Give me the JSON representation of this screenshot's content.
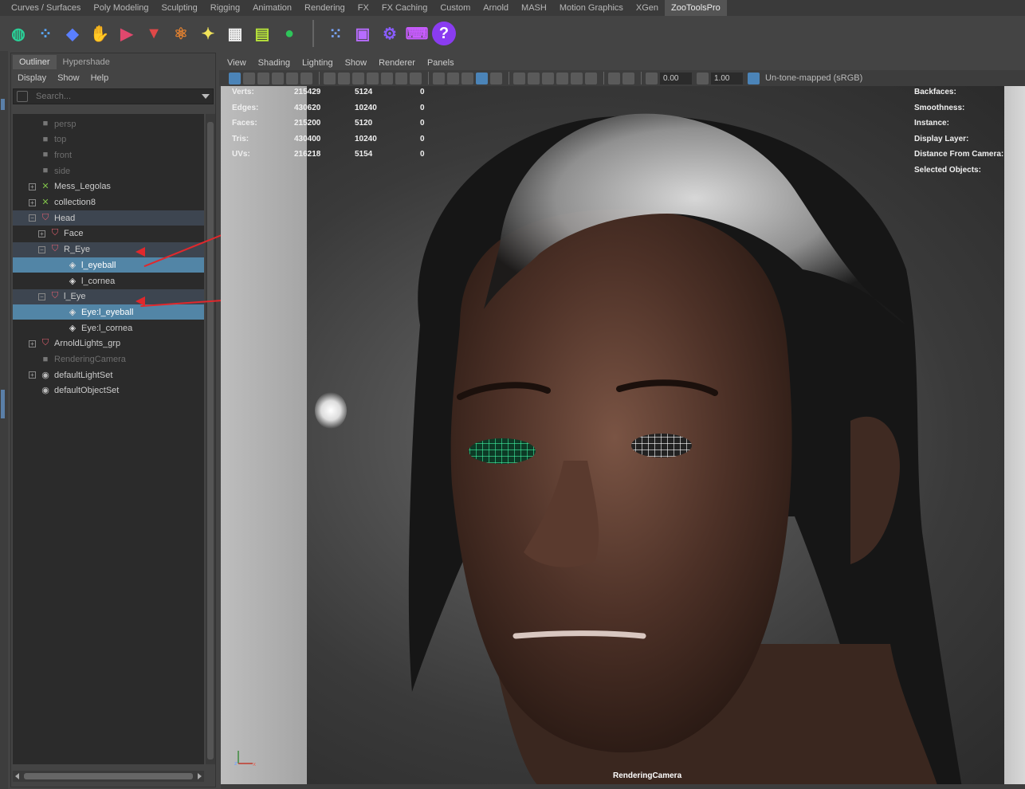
{
  "shelf_tabs": [
    "Curves / Surfaces",
    "Poly Modeling",
    "Sculpting",
    "Rigging",
    "Animation",
    "Rendering",
    "FX",
    "FX Caching",
    "Custom",
    "Arnold",
    "MASH",
    "Motion Graphics",
    "XGen",
    "ZooToolsPro"
  ],
  "active_shelf_tab": "ZooToolsPro",
  "shelf_icons": [
    "globe-icon",
    "dots-icon",
    "cube-icon",
    "rig-icon",
    "camera-icon",
    "paint-icon",
    "atom-icon",
    "bulb-icon",
    "checker-icon",
    "clapper-icon",
    "sphere-icon",
    "|",
    "zoo-dots-icon",
    "zoo-window-icon",
    "zoo-gear-icon",
    "zoo-keyboard-icon",
    "zoo-help-icon"
  ],
  "outliner": {
    "tabs": [
      "Outliner",
      "Hypershade"
    ],
    "menu": [
      "Display",
      "Show",
      "Help"
    ],
    "search_placeholder": "Search...",
    "rows": [
      {
        "label": "persp",
        "icon": "camera-icon",
        "level": 2,
        "dim": true
      },
      {
        "label": "top",
        "icon": "camera-icon",
        "level": 2,
        "dim": true
      },
      {
        "label": "front",
        "icon": "camera-icon",
        "level": 2,
        "dim": true
      },
      {
        "label": "side",
        "icon": "camera-icon",
        "level": 2,
        "dim": true
      },
      {
        "label": "Mess_Legolas",
        "icon": "set-icon",
        "level": 2,
        "expander": "+"
      },
      {
        "label": "collection8",
        "icon": "set-icon",
        "level": 2,
        "expander": "+"
      },
      {
        "label": "Head",
        "icon": "group-icon",
        "level": 2,
        "expander": "-",
        "parent": true
      },
      {
        "label": "Face",
        "icon": "group-icon",
        "level": 3,
        "expander": "+"
      },
      {
        "label": "R_Eye",
        "icon": "group-icon",
        "level": 3,
        "expander": "-",
        "parent": true
      },
      {
        "label": "l_eyeball",
        "icon": "mesh-icon",
        "level": 4,
        "selected": true
      },
      {
        "label": "l_cornea",
        "icon": "mesh-icon",
        "level": 4
      },
      {
        "label": "l_Eye",
        "icon": "group-icon",
        "level": 3,
        "expander": "-",
        "parent": true
      },
      {
        "label": "Eye:l_eyeball",
        "icon": "mesh-icon",
        "level": 4,
        "selected": true
      },
      {
        "label": "Eye:l_cornea",
        "icon": "mesh-icon",
        "level": 4
      },
      {
        "label": "ArnoldLights_grp",
        "icon": "group-icon",
        "level": 2,
        "expander": "+"
      },
      {
        "label": "RenderingCamera",
        "icon": "camera-icon",
        "level": 2,
        "dim": true
      },
      {
        "label": "defaultLightSet",
        "icon": "lightset-icon",
        "level": 2,
        "expander": "+"
      },
      {
        "label": "defaultObjectSet",
        "icon": "lightset-icon",
        "level": 2
      }
    ]
  },
  "viewport": {
    "menu": [
      "View",
      "Shading",
      "Lighting",
      "Show",
      "Renderer",
      "Panels"
    ],
    "gamma_value": "0.00",
    "exposure_value": "1.00",
    "colorspace": "Un-tone-mapped (sRGB)",
    "camera_label": "RenderingCamera",
    "hud_stats": [
      {
        "label": "Verts:",
        "a": "215429",
        "b": "5124",
        "c": "0"
      },
      {
        "label": "Edges:",
        "a": "430620",
        "b": "10240",
        "c": "0"
      },
      {
        "label": "Faces:",
        "a": "215200",
        "b": "5120",
        "c": "0"
      },
      {
        "label": "Tris:",
        "a": "430400",
        "b": "10240",
        "c": "0"
      },
      {
        "label": "UVs:",
        "a": "216218",
        "b": "5154",
        "c": "0"
      }
    ],
    "hud_right": [
      "Backfaces:",
      "Smoothness:",
      "Instance:",
      "Display Layer:",
      "Distance From Camera:",
      "Selected Objects:"
    ]
  },
  "colors": {
    "selection": "#5285a6",
    "annotation_arrow": "#e0282c",
    "active_eye_wire": "#3ef0a0"
  }
}
